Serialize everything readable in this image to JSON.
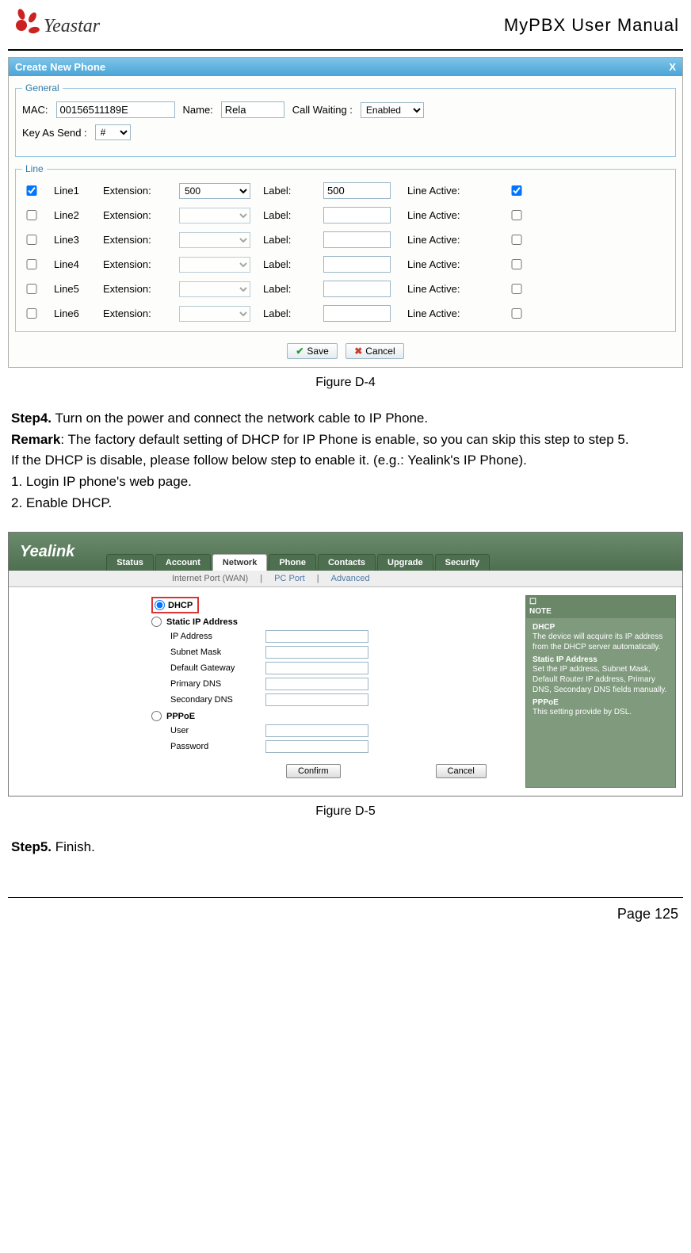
{
  "header": {
    "brand": "Yeastar",
    "doctitle": "MyPBX User Manual"
  },
  "figD4": {
    "title": "Create New Phone",
    "close": "X",
    "general": {
      "legend": "General",
      "mac_label": "MAC:",
      "mac_value": "00156511189E",
      "name_label": "Name:",
      "name_value": "Rela",
      "callwaiting_label": "Call Waiting :",
      "callwaiting_value": "Enabled",
      "keyassend_label": "Key As Send :",
      "keyassend_value": "#"
    },
    "line": {
      "legend": "Line",
      "ext_label": "Extension:",
      "lbl_label": "Label:",
      "la_label": "Line Active:",
      "rows": [
        {
          "chk": true,
          "name": "Line1",
          "ext": "500",
          "ext_disabled": false,
          "label": "500",
          "active": true
        },
        {
          "chk": false,
          "name": "Line2",
          "ext": "",
          "ext_disabled": true,
          "label": "",
          "active": false
        },
        {
          "chk": false,
          "name": "Line3",
          "ext": "",
          "ext_disabled": true,
          "label": "",
          "active": false
        },
        {
          "chk": false,
          "name": "Line4",
          "ext": "",
          "ext_disabled": true,
          "label": "",
          "active": false
        },
        {
          "chk": false,
          "name": "Line5",
          "ext": "",
          "ext_disabled": true,
          "label": "",
          "active": false
        },
        {
          "chk": false,
          "name": "Line6",
          "ext": "",
          "ext_disabled": true,
          "label": "",
          "active": false
        }
      ]
    },
    "save_label": "Save",
    "cancel_label": "Cancel",
    "caption": "Figure D-4"
  },
  "body": {
    "step4_bold": "Step4.",
    "step4_rest": " Turn on the power and connect the network cable to IP Phone.",
    "remark_bold": "Remark",
    "remark_rest": ": The factory default setting of DHCP for IP Phone is enable, so you can skip this step to step 5.",
    "para3": "If the DHCP is disable, please follow below step to enable it. (e.g.: Yealink's IP Phone).",
    "para4": "1. Login IP phone's web page.",
    "para5": "2. Enable DHCP."
  },
  "figD5": {
    "logo": "Yealink",
    "tabs": [
      "Status",
      "Account",
      "Network",
      "Phone",
      "Contacts",
      "Upgrade",
      "Security"
    ],
    "active_tab": 2,
    "subnav": {
      "a": "Internet Port (WAN)",
      "sep": "|",
      "b": "PC Port",
      "c": "Advanced"
    },
    "options": {
      "dhcp_label": "DHCP",
      "static_label": "Static IP Address",
      "pppoe_label": "PPPoE"
    },
    "fields": {
      "ip": "IP Address",
      "subnet": "Subnet Mask",
      "gateway": "Default Gateway",
      "pridns": "Primary DNS",
      "secdns": "Secondary DNS",
      "user": "User",
      "password": "Password"
    },
    "confirm": "Confirm",
    "cancel": "Cancel",
    "note": {
      "head": "NOTE",
      "dhcp_t": "DHCP",
      "dhcp_d": "The device will acquire its IP address from the DHCP server automatically.",
      "static_t": "Static IP Address",
      "static_d": "Set the IP address, Subnet Mask, Default Router IP address, Primary DNS, Secondary DNS fields manually.",
      "pppoe_t": "PPPoE",
      "pppoe_d": "This setting provide by DSL."
    },
    "caption": "Figure D-5"
  },
  "step5": {
    "bold": "Step5.",
    "rest": " Finish."
  },
  "footer": {
    "page": "Page 125"
  }
}
